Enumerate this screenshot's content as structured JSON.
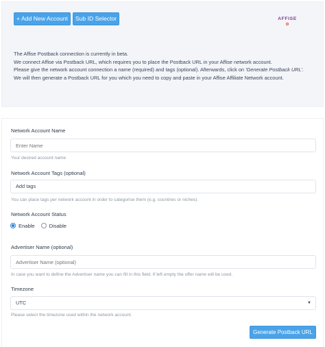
{
  "toolbar": {
    "add_account_label": "+ Add New Account",
    "sub_id_label": "Sub ID Selector"
  },
  "logo": {
    "text": "AFFISE",
    "accent_color": "#e0533d",
    "brand_color": "#7b3f8f"
  },
  "intro": {
    "line1": "The Affise Postback connection is currently in beta.",
    "line2": "We connect Affise via Postback URL, which requires you to place the Postback URL in your Affise network account.",
    "line3a": "Please give the network account connection a name (required) and tags (optional). Afterwards, click on ",
    "line3b": "'Generate Postback URL'.",
    "line4": "We will then generate a Postback URL for you which you need to copy and paste in your Affise Affiliate Network account."
  },
  "form": {
    "name": {
      "label": "Network Account Name",
      "placeholder": "Enter Name",
      "help": "Your desired account name"
    },
    "tags": {
      "label": "Network Account Tags (optional)",
      "value": "Add tags",
      "help": "You can place tags per network account in order to categorise them (e.g. countries or niches)."
    },
    "status": {
      "label": "Network Account Status",
      "options": [
        "Enable",
        "Disable"
      ],
      "selected": "Enable"
    },
    "advertiser": {
      "label": "Advertiser Name (optional)",
      "placeholder": "Advertiser Name (optional)",
      "help": "In case you want to define the Advertiser name you can fill in this field. If left empty the offer name will be used."
    },
    "timezone": {
      "label": "Timezone",
      "value": "UTC",
      "help": "Please select the timezone used within the network account."
    },
    "submit_label": "Generate Postback URL"
  },
  "colors": {
    "button": "#4aa3e8",
    "radio_selected": "#1f7de0",
    "panel_bg": "#f3f5f9"
  }
}
